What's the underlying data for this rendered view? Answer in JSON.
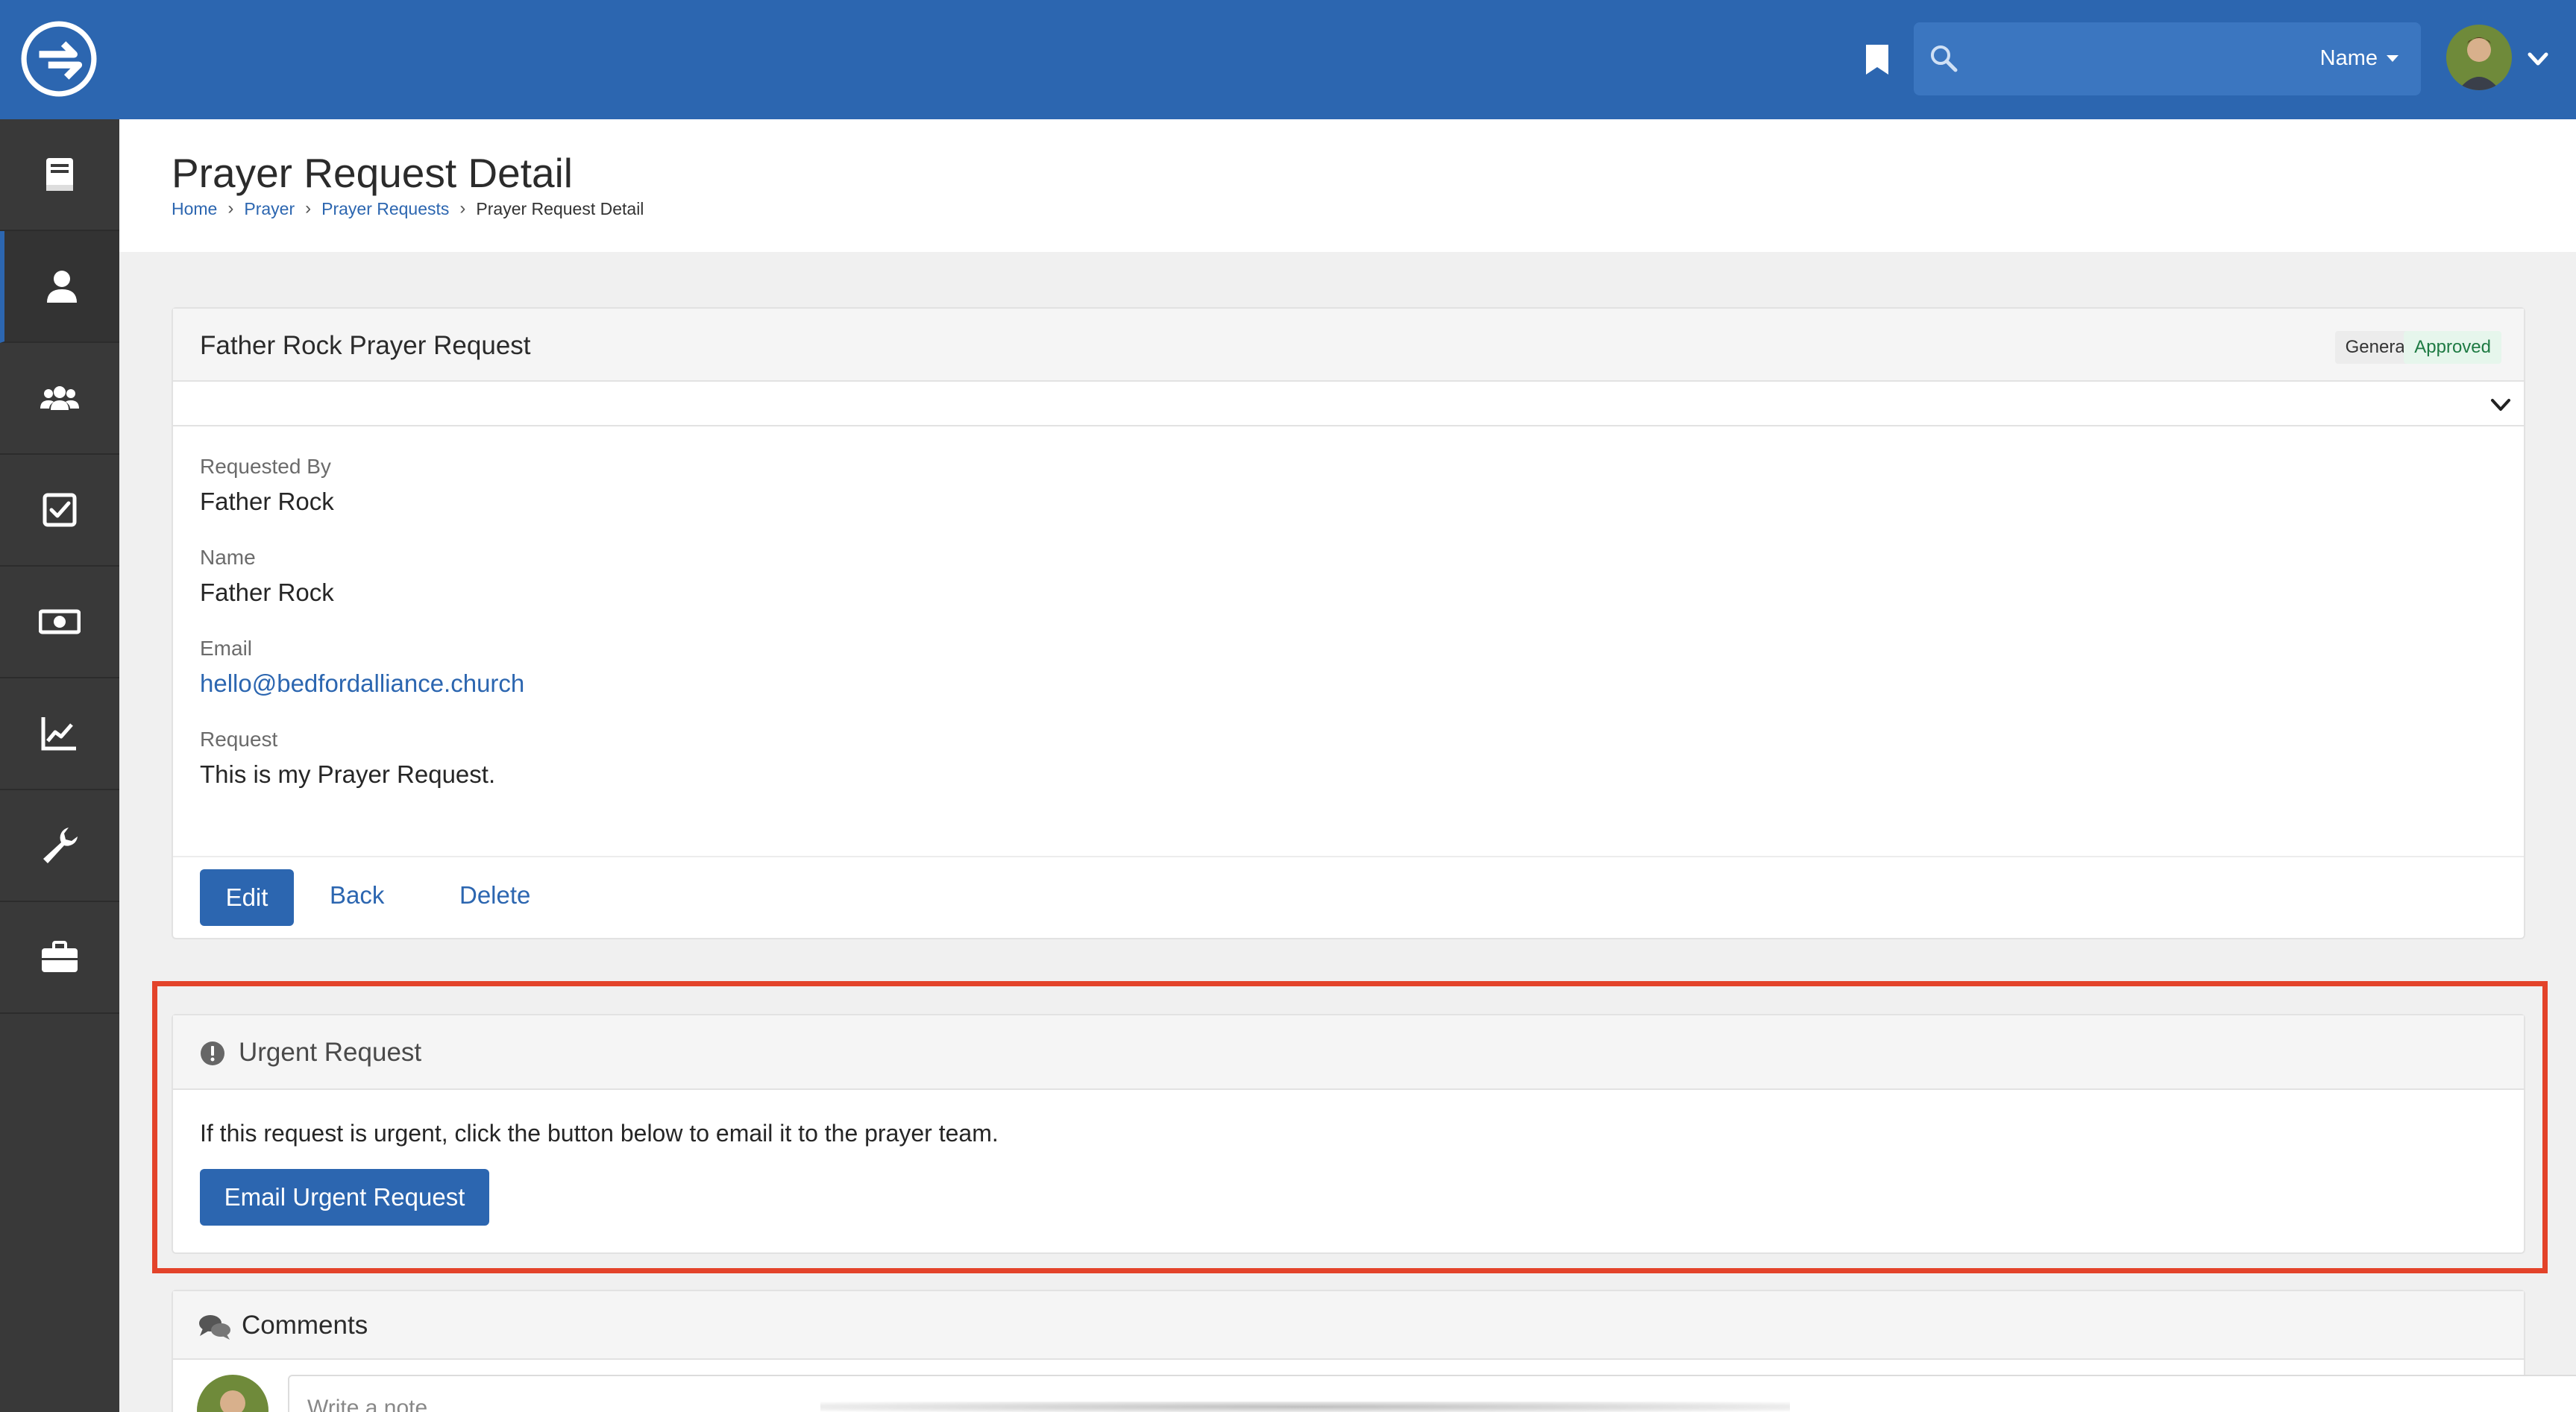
{
  "header": {
    "search_scope": "Name"
  },
  "page": {
    "title": "Prayer Request Detail",
    "breadcrumb": [
      "Home",
      "Prayer",
      "Prayer Requests",
      "Prayer Request Detail"
    ]
  },
  "request_panel": {
    "title": "Father Rock Prayer Request",
    "badges": [
      "General",
      "Approved"
    ],
    "fields": [
      {
        "label": "Requested By",
        "value": "Father Rock"
      },
      {
        "label": "Name",
        "value": "Father Rock"
      },
      {
        "label": "Email",
        "value": "hello@bedfordalliance.church"
      },
      {
        "label": "Request",
        "value": "This is my Prayer Request."
      }
    ],
    "actions": {
      "edit": "Edit",
      "back": "Back",
      "delete": "Delete"
    }
  },
  "urgent_panel": {
    "title": "Urgent Request",
    "text": "If this request is urgent, click the button below to email it to the prayer team.",
    "button": "Email Urgent Request"
  },
  "comments_panel": {
    "title": "Comments",
    "note_placeholder": "Write a note..."
  },
  "colors": {
    "brand": "#2c66b0",
    "sidebar": "#393939",
    "highlight": "#e3432a"
  }
}
